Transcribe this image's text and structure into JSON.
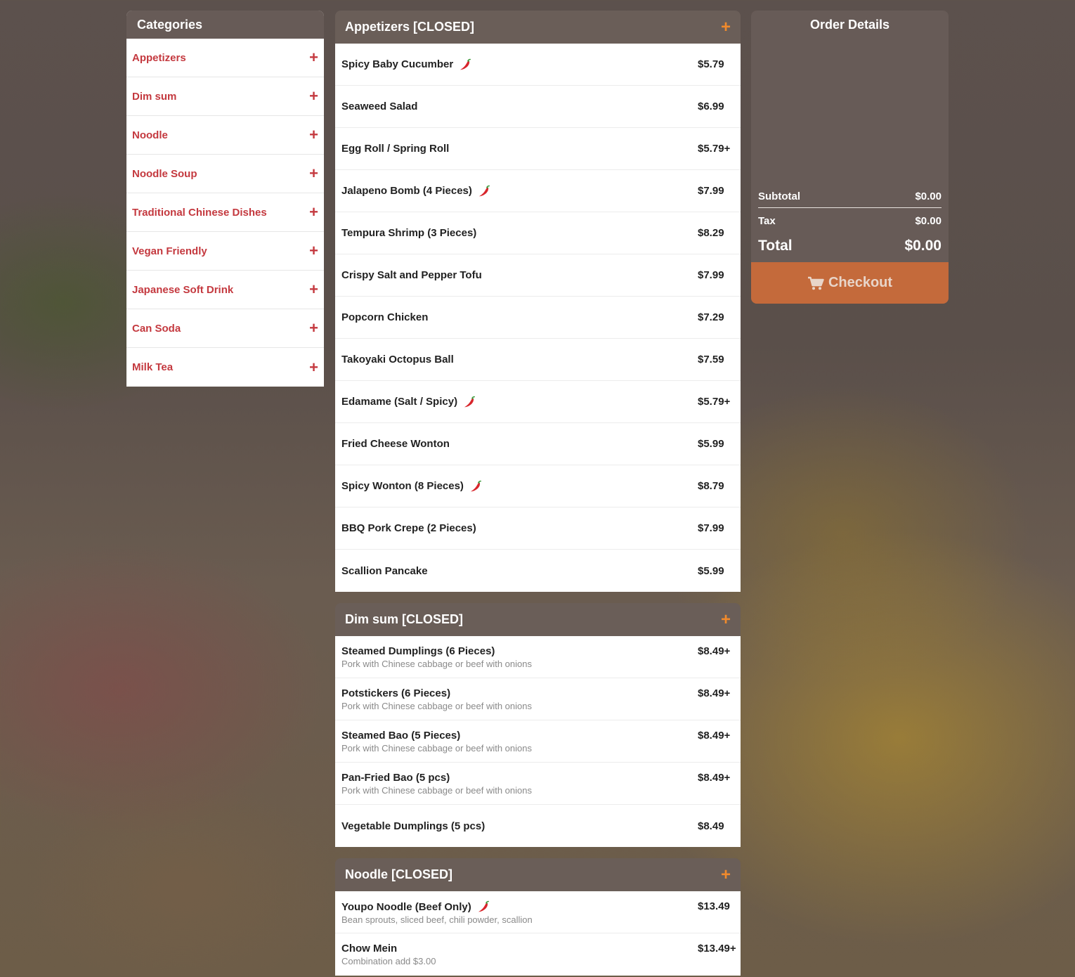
{
  "categories": {
    "title": "Categories",
    "items": [
      {
        "label": "Appetizers"
      },
      {
        "label": "Dim sum"
      },
      {
        "label": "Noodle"
      },
      {
        "label": "Noodle Soup"
      },
      {
        "label": "Traditional Chinese Dishes"
      },
      {
        "label": "Vegan Friendly"
      },
      {
        "label": "Japanese Soft Drink"
      },
      {
        "label": "Can Soda"
      },
      {
        "label": "Milk Tea"
      }
    ]
  },
  "sections": [
    {
      "title": "Appetizers [CLOSED]",
      "items": [
        {
          "name": "Spicy Baby Cucumber",
          "price": "$5.79",
          "spicy": true
        },
        {
          "name": "Seaweed Salad",
          "price": "$6.99"
        },
        {
          "name": "Egg Roll / Spring Roll",
          "price": "$5.79+"
        },
        {
          "name": "Jalapeno Bomb (4 Pieces)",
          "price": "$7.99",
          "spicy": true
        },
        {
          "name": "Tempura Shrimp (3 Pieces)",
          "price": "$8.29"
        },
        {
          "name": "Crispy Salt and Pepper Tofu",
          "price": "$7.99"
        },
        {
          "name": "Popcorn Chicken",
          "price": "$7.29"
        },
        {
          "name": "Takoyaki Octopus Ball",
          "price": "$7.59"
        },
        {
          "name": "Edamame (Salt / Spicy)",
          "price": "$5.79+",
          "spicy": true
        },
        {
          "name": "Fried Cheese Wonton",
          "price": "$5.99"
        },
        {
          "name": "Spicy Wonton (8 Pieces)",
          "price": "$8.79",
          "spicy": true
        },
        {
          "name": "BBQ Pork Crepe (2 Pieces)",
          "price": "$7.99"
        },
        {
          "name": "Scallion Pancake",
          "price": "$5.99"
        }
      ]
    },
    {
      "title": "Dim sum [CLOSED]",
      "items": [
        {
          "name": "Steamed Dumplings (6 Pieces)",
          "price": "$8.49+",
          "desc": "Pork with Chinese cabbage or beef with onions"
        },
        {
          "name": "Potstickers (6 Pieces)",
          "price": "$8.49+",
          "desc": "Pork with Chinese cabbage or beef with onions"
        },
        {
          "name": "Steamed Bao (5 Pieces)",
          "price": "$8.49+",
          "desc": "Pork with Chinese cabbage or beef with onions"
        },
        {
          "name": "Pan-Fried Bao (5 pcs)",
          "price": "$8.49+",
          "desc": "Pork with Chinese cabbage or beef with onions"
        },
        {
          "name": "Vegetable Dumplings (5 pcs)",
          "price": "$8.49"
        }
      ]
    },
    {
      "title": "Noodle [CLOSED]",
      "items": [
        {
          "name": "Youpo Noodle (Beef Only)",
          "price": "$13.49",
          "desc": "Bean sprouts, sliced beef, chili powder, scallion",
          "spicy": true
        },
        {
          "name": "Chow Mein",
          "price": "$13.49+",
          "desc": "Combination add $3.00"
        }
      ]
    }
  ],
  "order": {
    "title": "Order Details",
    "subtotal_label": "Subtotal",
    "subtotal": "$0.00",
    "tax_label": "Tax",
    "tax": "$0.00",
    "total_label": "Total",
    "total": "$0.00",
    "checkout_label": "Checkout"
  },
  "icons": {
    "add": "plus-icon",
    "spicy": "chili-pepper-icon",
    "cart": "cart-icon"
  },
  "colors": {
    "category_text": "#c4393f",
    "section_plus": "#f08a2c",
    "checkout_bg": "#c46a3b",
    "panel_header": "#675b57"
  }
}
